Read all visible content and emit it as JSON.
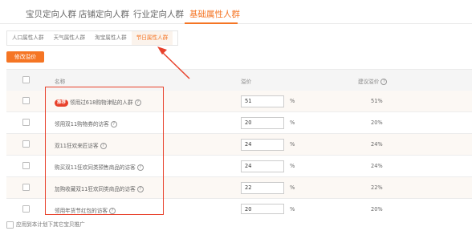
{
  "top_tabs": [
    {
      "label": "宝贝定向人群"
    },
    {
      "label": "店铺定向人群"
    },
    {
      "label": "行业定向人群"
    },
    {
      "label": "基础属性人群",
      "active": true
    }
  ],
  "sub_tabs": [
    {
      "label": "人口属性人群"
    },
    {
      "label": "天气属性人群"
    },
    {
      "label": "淘宝属性人群"
    },
    {
      "label": "节日属性人群",
      "active": true
    }
  ],
  "bid_button": "修改溢价",
  "table": {
    "headers": {
      "name": "名称",
      "premium": "溢价",
      "suggested": "建议溢价"
    },
    "rows": [
      {
        "badge": "推荐",
        "name": "领用过618购物津贴的人群",
        "premium": "51",
        "unit": "%",
        "suggested": "51%"
      },
      {
        "badge": "",
        "name": "领用双11购物券的访客",
        "premium": "20",
        "unit": "%",
        "suggested": "20%"
      },
      {
        "badge": "",
        "name": "双11狂欢来匠访客",
        "premium": "24",
        "unit": "%",
        "suggested": "24%"
      },
      {
        "badge": "",
        "name": "购买双11狂欢同类预售商品的访客",
        "premium": "24",
        "unit": "%",
        "suggested": "24%"
      },
      {
        "badge": "",
        "name": "加购收藏双11狂欢同类商品的访客",
        "premium": "22",
        "unit": "%",
        "suggested": "22%"
      },
      {
        "badge": "",
        "name": "领用年货节红包的访客",
        "premium": "20",
        "unit": "%",
        "suggested": "20%"
      }
    ]
  },
  "footer": {
    "label": "应用到本计划下其它宝贝推广"
  },
  "colors": {
    "accent": "#f57524",
    "highlight": "#e8412b"
  }
}
